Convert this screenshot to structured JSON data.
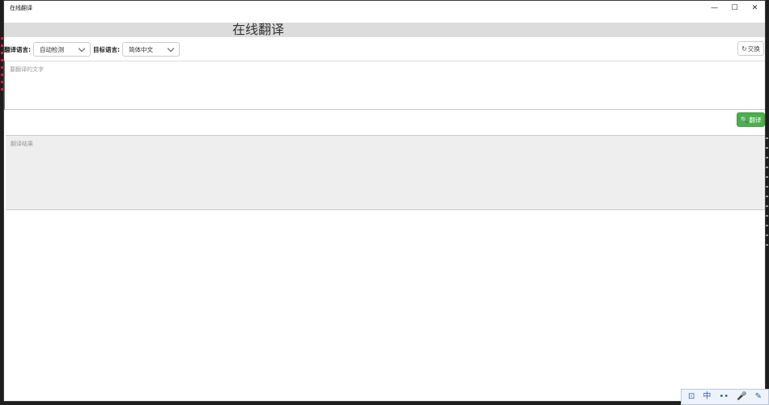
{
  "window": {
    "title": "在线翻译"
  },
  "controls": {
    "minimize": "—",
    "maximize": "☐",
    "close": "✕"
  },
  "page": {
    "title": "在线翻译"
  },
  "source_lang": {
    "label": "翻译语言:",
    "selected": "自动检测"
  },
  "target_lang": {
    "label": "目标语言:",
    "selected": "简体中文"
  },
  "swap_button": {
    "icon": "↻",
    "label": "交换"
  },
  "input": {
    "placeholder": "要翻译的文字",
    "value": ""
  },
  "translate_button": {
    "icon": "🔍",
    "label": "翻译"
  },
  "result": {
    "placeholder": "翻译结果"
  },
  "ime_toolbar": {
    "icons": [
      "⊡",
      "中",
      "••",
      "🎤",
      "✎"
    ]
  },
  "colors": {
    "accent_green": "#4cae4c",
    "band_gray": "#dcdcdc",
    "result_bg": "#eeeeee"
  }
}
